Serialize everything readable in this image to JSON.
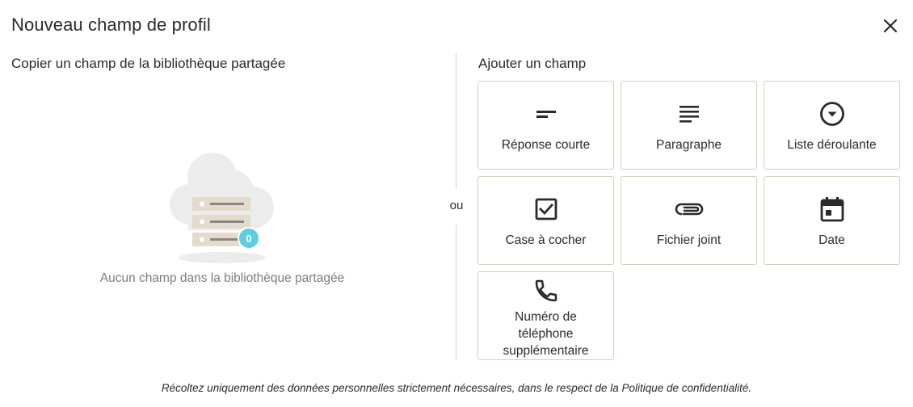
{
  "dialog": {
    "title": "Nouveau champ de profil",
    "close_icon": "close-icon"
  },
  "left": {
    "heading": "Copier un champ de la bibliothèque partagée",
    "empty_text": "Aucun champ dans la bibliothèque partagée",
    "badge_count": "0",
    "illustration": "cloud-server-icon"
  },
  "separator": {
    "label": "ou"
  },
  "right": {
    "heading": "Ajouter un champ",
    "field_types": [
      {
        "label": "Réponse courte",
        "icon": "short-text-icon"
      },
      {
        "label": "Paragraphe",
        "icon": "paragraph-icon"
      },
      {
        "label": "Liste déroulante",
        "icon": "dropdown-icon"
      },
      {
        "label": "Case à cocher",
        "icon": "checkbox-icon"
      },
      {
        "label": "Fichier joint",
        "icon": "attachment-icon"
      },
      {
        "label": "Date",
        "icon": "calendar-icon"
      },
      {
        "label": "Numéro de téléphone supplémentaire",
        "icon": "phone-icon"
      }
    ]
  },
  "footer": {
    "text": "Récoltez uniquement des données personnelles strictement nécessaires, dans le respect de la Politique de confidentialité."
  },
  "colors": {
    "card_border": "#d6cfbf",
    "badge": "#5bcfe0",
    "icon": "#2a2a2a"
  }
}
